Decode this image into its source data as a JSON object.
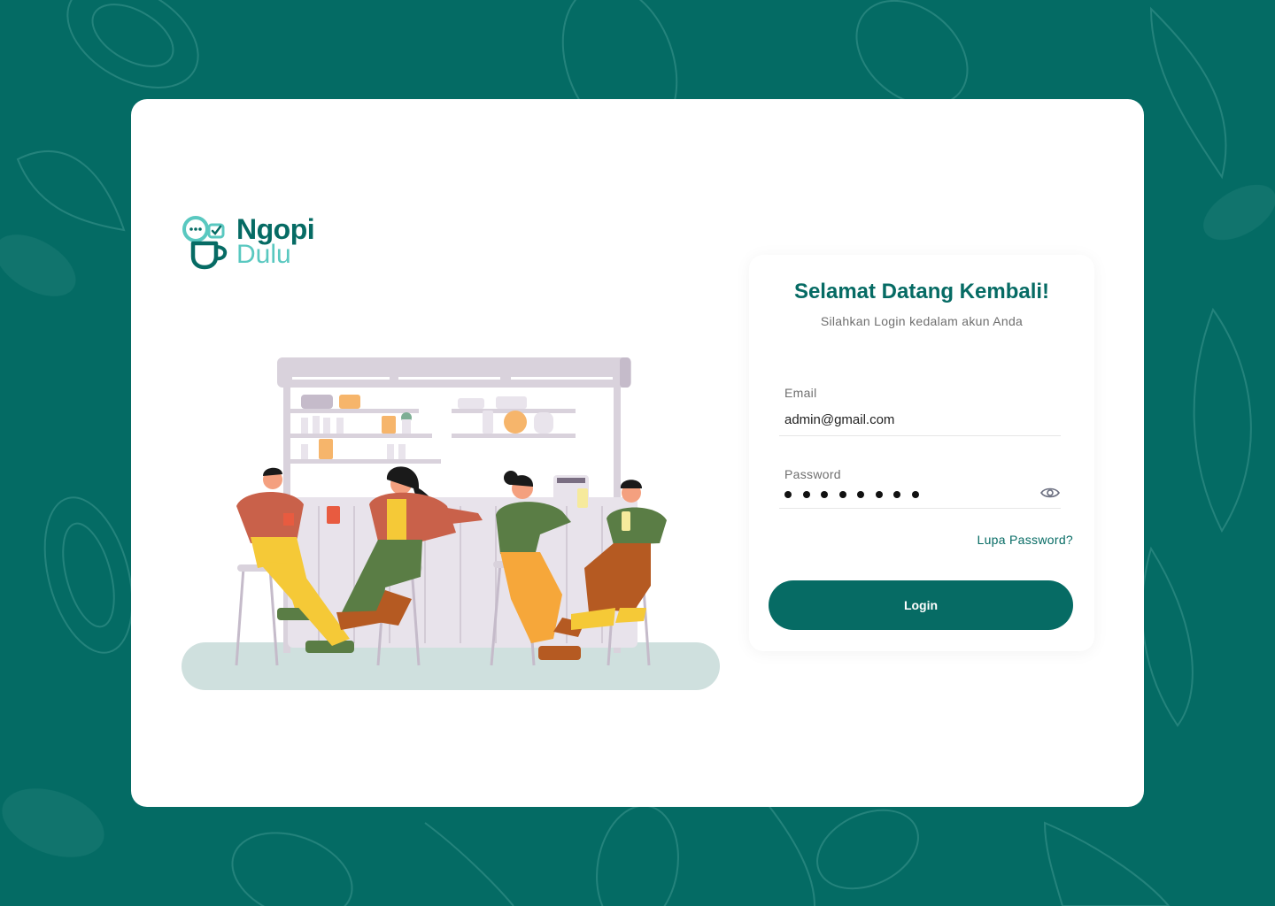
{
  "brand": {
    "name_line1": "Ngopi",
    "name_line2": "Dulu",
    "primary_color": "#066B64",
    "secondary_color": "#59C8C0"
  },
  "background": {
    "color": "#046B64",
    "pattern": "coffee-bean-leaf-pattern"
  },
  "login": {
    "title": "Selamat Datang Kembali!",
    "subtitle": "Silahkan Login kedalam akun Anda",
    "email_label": "Email",
    "email_value": "admin@gmail.com",
    "password_label": "Password",
    "password_mask_count": 8,
    "show_password_icon": "eye-icon",
    "forgot_password": "Lupa Password?",
    "login_button": "Login"
  },
  "illustration": "friends-drinking-coffee-at-bar"
}
